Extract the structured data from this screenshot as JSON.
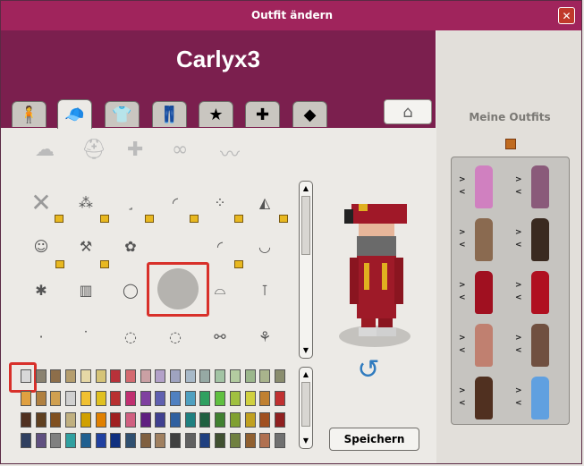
{
  "window": {
    "title": "Outfit ändern",
    "close_label": "✕"
  },
  "header": {
    "username": "Carlyx3"
  },
  "tabs": [
    {
      "name": "body",
      "icon": "person-icon",
      "glyph": "🧍"
    },
    {
      "name": "head",
      "icon": "cap-icon",
      "glyph": "🧢"
    },
    {
      "name": "top",
      "icon": "shirt-icon",
      "glyph": "👕"
    },
    {
      "name": "bottom",
      "icon": "trousers-icon",
      "glyph": "👖"
    },
    {
      "name": "accessories",
      "icon": "star-icon",
      "glyph": "★"
    },
    {
      "name": "effects",
      "icon": "add-person-icon",
      "glyph": "✚"
    },
    {
      "name": "special",
      "icon": "cube-icon",
      "glyph": "◆"
    }
  ],
  "hanger": {
    "icon": "hanger-icon",
    "glyph": "⌂"
  },
  "category_icons": [
    {
      "name": "hair-icon",
      "glyph": "☁"
    },
    {
      "name": "hat-icon",
      "glyph": "⛑"
    },
    {
      "name": "hair-accessory-icon",
      "glyph": "✚"
    },
    {
      "name": "glasses-icon",
      "glyph": "∞"
    },
    {
      "name": "moustache-icon",
      "glyph": "〰"
    }
  ],
  "sidebar": {
    "title": "Meine Outfits"
  },
  "outfit_arrow_right": ">",
  "outfit_arrow_left": "<",
  "save_button": {
    "label": "Speichern"
  },
  "rotate": {
    "glyph": "↺"
  },
  "colors": {
    "title_bar": "#a0245c",
    "header": "#7b1f4e",
    "selection": "#d8302a",
    "rotate_arrow": "#2f7bbf"
  },
  "swatch_row1": [
    "#d8d8d8",
    "#8a8270",
    "#8d6e4a",
    "#b59e6e",
    "#e6d8a6",
    "#d6c478",
    "#b8323a",
    "#d46a70",
    "#caa0a4",
    "#b3a1c9",
    "#9fa3c0",
    "#a8b9c8",
    "#96a9a4",
    "#a3c4a4",
    "#b3cca0",
    "#9cb78c",
    "#a9b48c",
    "#8a8d6e"
  ],
  "swatch_row2": [
    "#e0a040",
    "#b08040",
    "#d0a050",
    "#d0d0d0",
    "#f0c030",
    "#e0c020",
    "#b83030",
    "#c03070",
    "#8040a0",
    "#6060b0",
    "#5080c0",
    "#50a0c0",
    "#30a060",
    "#60c040",
    "#a0c040",
    "#d0d040",
    "#c08030",
    "#c03030"
  ],
  "swatch_row3": [
    "#503020",
    "#604020",
    "#805020",
    "#c0b080",
    "#d0a000",
    "#e08000",
    "#a02020",
    "#d06080",
    "#602080",
    "#404090",
    "#3060a0",
    "#208080",
    "#206040",
    "#408030",
    "#80a030",
    "#c0a020",
    "#a05020",
    "#902020"
  ],
  "swatch_row4": [
    "#304060",
    "#605080",
    "#808080",
    "#30a0a0",
    "#206090",
    "#2040a0",
    "#103080",
    "#305070",
    "#806040",
    "#a08060",
    "#404040",
    "#606060",
    "#204080",
    "#405030",
    "#708040",
    "#906030",
    "#b07050",
    "#707070"
  ],
  "outfits": [
    {
      "left_color": "#d080c0",
      "right_color": "#8a5a7a"
    },
    {
      "left_color": "#8a6a50",
      "right_color": "#3a2a20"
    },
    {
      "left_color": "#a01020",
      "right_color": "#b01020"
    },
    {
      "left_color": "#c08070",
      "right_color": "#705040"
    },
    {
      "left_color": "#503020",
      "right_color": "#60a0e0"
    }
  ]
}
